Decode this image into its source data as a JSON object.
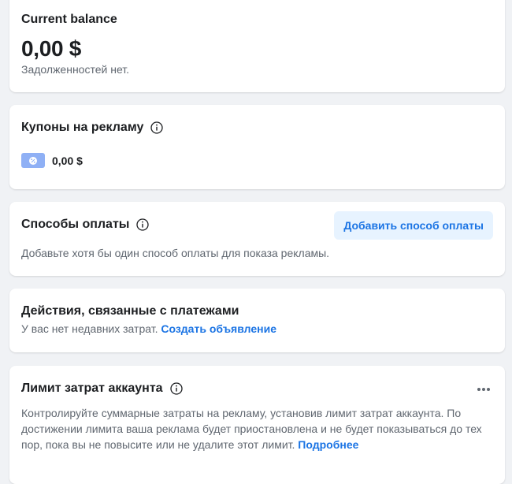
{
  "balance": {
    "title": "Current balance",
    "amount": "0,00 $",
    "debt_status": "Задолженностей нет."
  },
  "coupons": {
    "title": "Купоны на рекламу",
    "value": "0,00 $",
    "badge_icon": "coupon-percent-icon"
  },
  "payment_methods": {
    "title": "Способы оплаты",
    "add_button": "Добавить способ оплаты",
    "description": "Добавьте хотя бы один способ оплаты для показа рекламы."
  },
  "payment_activity": {
    "title": "Действия, связанные с платежами",
    "description": "У вас нет недавних затрат.",
    "link": "Создать объявление"
  },
  "spending_limit": {
    "title": "Лимит затрат аккаунта",
    "description": "Контролируйте суммарные затраты на рекламу, установив лимит затрат аккаунта. По достижении лимита ваша реклама будет приостановлена и не будет показываться до тех пор, пока вы не повысите или не удалите этот лимит.",
    "link": "Подробнее",
    "more_icon": "more-horizontal-icon"
  },
  "colors": {
    "background": "#f0f2f5",
    "card": "#ffffff",
    "accent": "#1b74e4",
    "button_bg": "#e7f3ff",
    "coupon_badge": "#8fb0f5",
    "secondary_text": "#606770"
  }
}
